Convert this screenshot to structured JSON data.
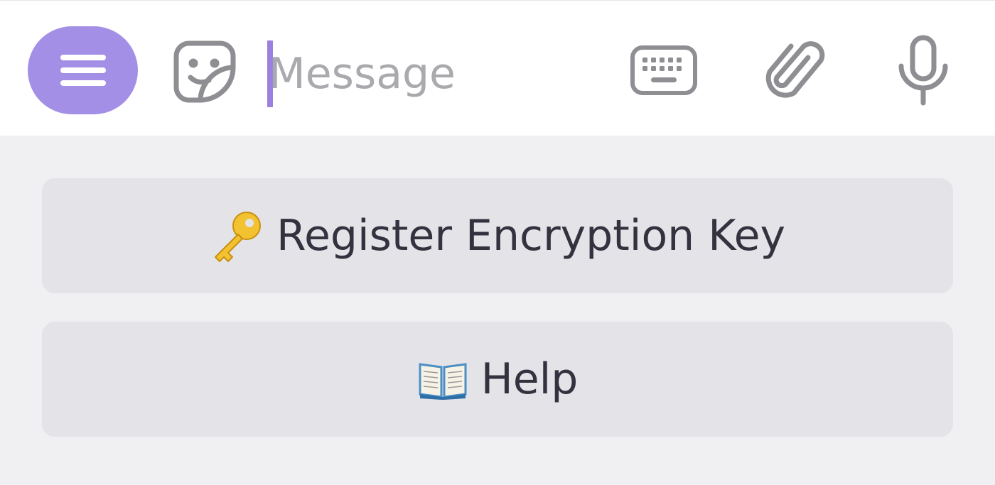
{
  "composer": {
    "placeholder": "Message",
    "value": "",
    "accent_color": "#a48fe6",
    "caret_color": "#9a80e0",
    "icons": {
      "menu": "hamburger-menu-icon",
      "sticker": "sticker-smile-icon",
      "keyboard": "keyboard-icon",
      "attach": "paperclip-icon",
      "voice": "microphone-icon"
    }
  },
  "reply_keyboard": {
    "buttons": [
      {
        "emoji": "🔑",
        "label": "Register Encryption Key",
        "icon": "key-icon"
      },
      {
        "emoji": "📖",
        "label": "Help",
        "icon": "open-book-icon"
      }
    ]
  },
  "colors": {
    "panel_bg": "#f0f0f3",
    "button_bg": "#e4e4e8",
    "button_text": "#34323f",
    "icon_gray": "#8e8e93"
  }
}
